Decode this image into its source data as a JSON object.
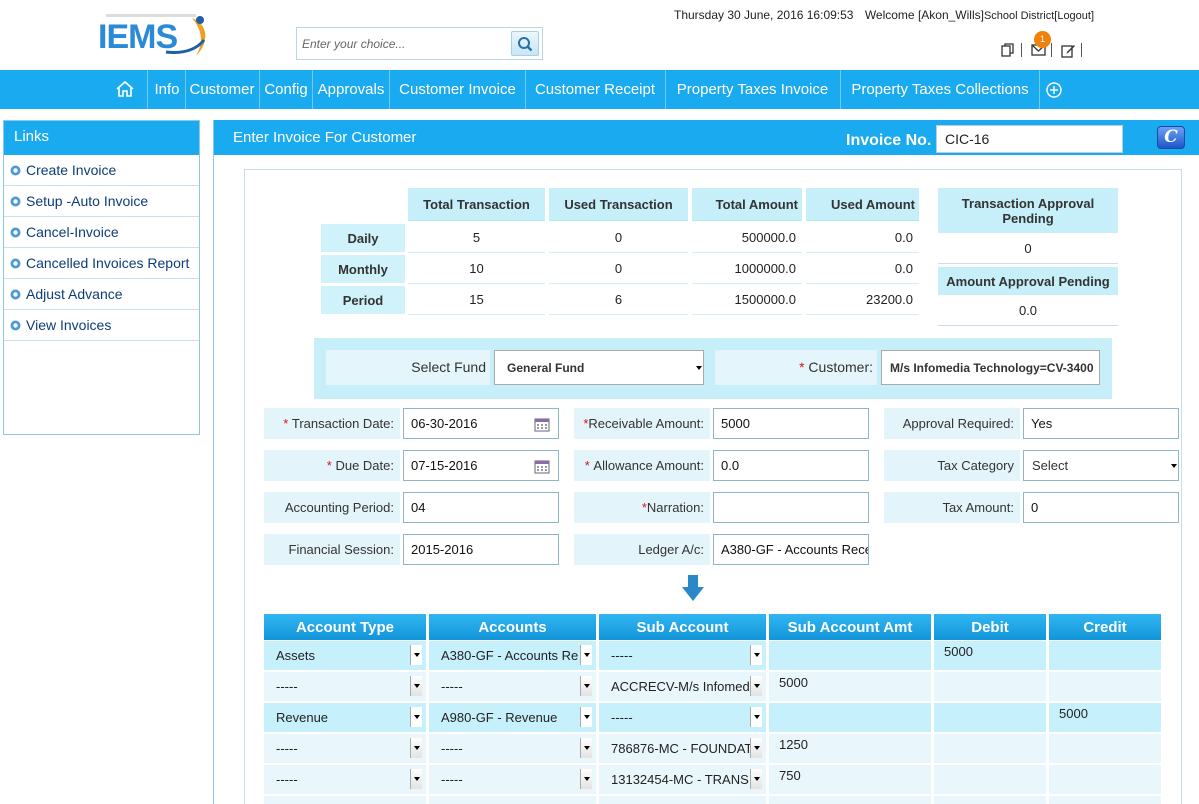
{
  "header": {
    "search_placeholder": "Enter your choice...",
    "datetime": "Thursday 30 June, 2016 16:09:53",
    "welcome_prefix": "Welcome [Akon_Wills]",
    "district": "School District",
    "logout": "[Logout]",
    "notification_count": "1"
  },
  "nav": {
    "items": [
      "Info",
      "Customer",
      "Config",
      "Approvals",
      "Customer Invoice",
      "Customer Receipt",
      "Property Taxes Invoice",
      "Property Taxes Collections"
    ]
  },
  "sidebar": {
    "title": "Links",
    "items": [
      "Create Invoice",
      "Setup -Auto Invoice",
      "Cancel-Invoice",
      "Cancelled Invoices Report",
      "Adjust Advance",
      "View Invoices"
    ]
  },
  "main": {
    "title": "Enter Invoice For Customer",
    "invoice_label": "Invoice No.",
    "invoice_no": "CIC-16",
    "c_button": "C"
  },
  "stats": {
    "headers": [
      "Total Transaction",
      "Used Transaction",
      "Total Amount",
      "Used Amount"
    ],
    "rows": [
      {
        "label": "Daily",
        "values": [
          "5",
          "0",
          "500000.0",
          "0.0"
        ]
      },
      {
        "label": "Monthly",
        "values": [
          "10",
          "0",
          "1000000.0",
          "0.0"
        ]
      },
      {
        "label": "Period",
        "values": [
          "15",
          "6",
          "1500000.0",
          "23200.0"
        ]
      }
    ],
    "txn_approval_label": "Transaction Approval Pending",
    "txn_approval_value": "0",
    "amt_approval_label": "Amount Approval Pending",
    "amt_approval_value": "0.0"
  },
  "fund": {
    "label": "Select Fund",
    "value": "General Fund",
    "customer_label": "Customer:",
    "customer_value": "M/s Infomedia Technology=CV-3400"
  },
  "form": {
    "transaction_date_label": "Transaction Date:",
    "transaction_date": "06-30-2016",
    "due_date_label": "Due Date:",
    "due_date": "07-15-2016",
    "accounting_period_label": "Accounting Period:",
    "accounting_period": "04",
    "financial_session_label": "Financial Session:",
    "financial_session": "2015-2016",
    "receivable_label": "Receivable Amount:",
    "receivable": "5000",
    "allowance_label": "Allowance Amount:",
    "allowance": "0.0",
    "narration_label": "Narration:",
    "narration": "",
    "ledger_label": "Ledger A/c:",
    "ledger": "A380-GF - Accounts Rece",
    "approval_label": "Approval Required:",
    "approval": "Yes",
    "tax_category_label": "Tax Category",
    "tax_category": "Select",
    "tax_amount_label": "Tax Amount:",
    "tax_amount": "0"
  },
  "grid": {
    "headers": [
      "Account Type",
      "Accounts",
      "Sub Account",
      "Sub Account Amt",
      "Debit",
      "Credit"
    ],
    "rows": [
      {
        "type": "Assets",
        "account": "A380-GF - Accounts Re",
        "sub": "-----",
        "amt": "",
        "debit": "5000",
        "credit": ""
      },
      {
        "type": "-----",
        "account": "-----",
        "sub": "ACCRECV-M/s Infomed",
        "amt": "5000",
        "debit": "",
        "credit": ""
      },
      {
        "type": "Revenue",
        "account": "A980-GF - Revenue",
        "sub": "-----",
        "amt": "",
        "debit": "",
        "credit": "5000"
      },
      {
        "type": "-----",
        "account": "-----",
        "sub": "786876-MC - FOUNDAT",
        "amt": "1250",
        "debit": "",
        "credit": ""
      },
      {
        "type": "-----",
        "account": "-----",
        "sub": "13132454-MC - TRANS",
        "amt": "750",
        "debit": "",
        "credit": ""
      }
    ]
  },
  "colors": {
    "accent": "#1aaaf0",
    "header_cell": "#c6effa",
    "highlight_row": "#c6f0fb",
    "plain_row": "#e9f6fc"
  }
}
